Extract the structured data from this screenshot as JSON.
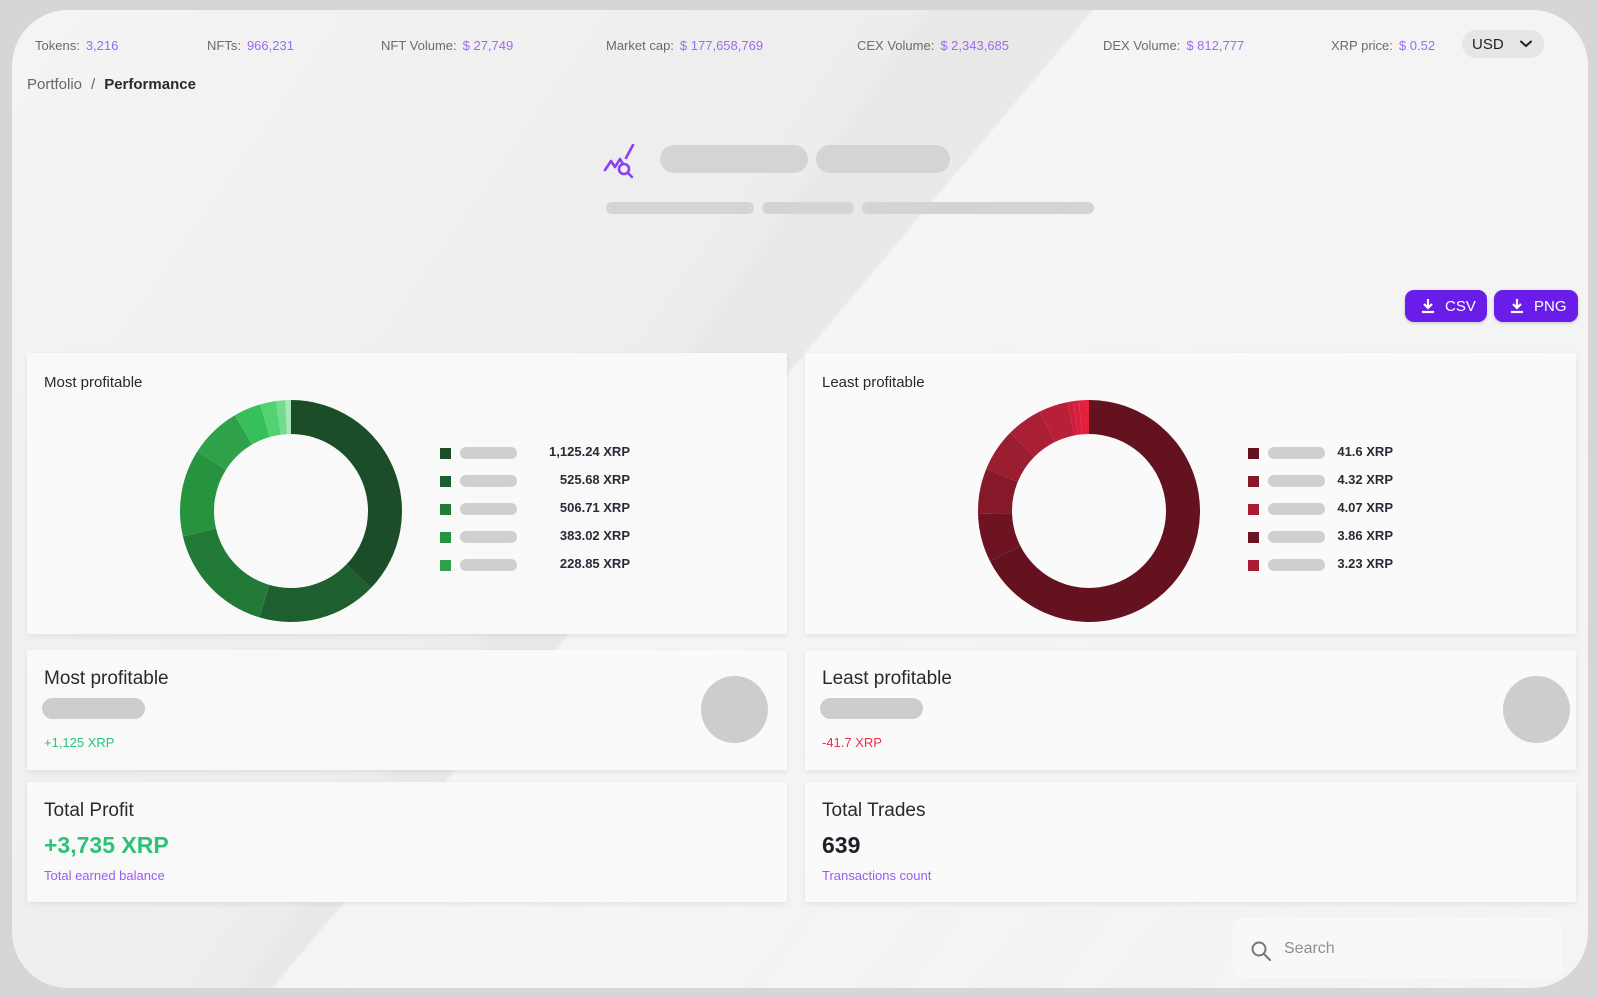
{
  "stats_bar": {
    "items": [
      {
        "label": "Tokens:",
        "value": "3,216"
      },
      {
        "label": "NFTs:",
        "value": "966,231"
      },
      {
        "label": "NFT Volume:",
        "value": "$ 27,749"
      },
      {
        "label": "Market cap:",
        "value": "$ 177,658,769"
      },
      {
        "label": "CEX Volume:",
        "value": "$ 2,343,685"
      },
      {
        "label": "DEX Volume:",
        "value": "$ 812,777"
      },
      {
        "label": "XRP price:",
        "value": "$ 0.52"
      }
    ],
    "currency": "USD",
    "accent_color": "#9b6bf0"
  },
  "breadcrumb": {
    "parent": "Portfolio",
    "separator": "/",
    "current": "Performance"
  },
  "hero": {
    "icon": "chart-search-icon"
  },
  "export_buttons": {
    "csv_label": "CSV",
    "png_label": "PNG",
    "color": "#6a1de8"
  },
  "chart_data": [
    {
      "type": "pie",
      "title": "Most profitable",
      "donut": true,
      "unit": "XRP",
      "values": [
        1125.24,
        525.68,
        506.71,
        383.02,
        228.85,
        120,
        70,
        40,
        25
      ],
      "legend_values": [
        "1,125.24 XRP",
        "525.68 XRP",
        "506.71 XRP",
        "383.02 XRP",
        "228.85 XRP"
      ],
      "colors": [
        "#1b4d29",
        "#1e5f2f",
        "#227a37",
        "#28933f",
        "#2ea14a",
        "#37c05a",
        "#53d273",
        "#72dc8e",
        "#a8e8b8"
      ],
      "legend": "right"
    },
    {
      "type": "pie",
      "title": "Least profitable",
      "donut": true,
      "unit": "XRP",
      "values": [
        41.6,
        4.32,
        4.07,
        3.86,
        3.23,
        2.6,
        0.5,
        0.5,
        0.9
      ],
      "legend_values": [
        "41.6 XRP",
        "4.32 XRP",
        "4.07 XRP",
        "3.86 XRP",
        "3.23 XRP"
      ],
      "colors": [
        "#641120",
        "#6d1322",
        "#861929",
        "#9b1d30",
        "#aa1f34",
        "#b81f38",
        "#cc1f3b",
        "#d91f3d",
        "#e5203e"
      ],
      "legend_colors": [
        "#641120",
        "#861929",
        "#a81d34",
        "#6d1322",
        "#a81d34"
      ],
      "legend": "right"
    }
  ],
  "summary_cards": {
    "most": {
      "title": "Most profitable",
      "value": "+1,125 XRP",
      "color": "#2bc27a"
    },
    "least": {
      "title": "Least profitable",
      "value": "-41.7 XRP",
      "color": "#e5314d"
    }
  },
  "totals": {
    "profit": {
      "title": "Total Profit",
      "value": "+3,735 XRP",
      "caption": "Total earned balance"
    },
    "trades": {
      "title": "Total Trades",
      "value": "639",
      "caption": "Transactions count"
    }
  },
  "search": {
    "placeholder": "Search"
  }
}
